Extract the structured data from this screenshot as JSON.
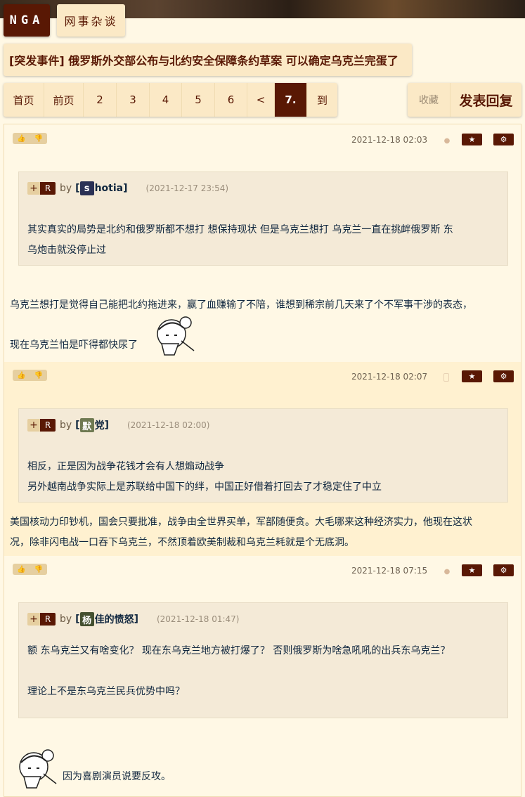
{
  "header": {
    "logo": "NGA",
    "section": "网事杂谈",
    "thread_title": "[突发事件] 俄罗斯外交部公布与北约安全保障条约草案 可以确定乌克兰完蛋了"
  },
  "pager": {
    "pages": [
      "首页",
      "前页",
      "2",
      "3",
      "4",
      "5",
      "6",
      "<",
      "7.",
      "到"
    ],
    "current": "7."
  },
  "actions": {
    "favorite": "收藏",
    "reply": "发表回复"
  },
  "colors": {
    "accent": "#591804",
    "quote_bg": "#f4ead7",
    "alt_row": "#fff1d0"
  },
  "posts": [
    {
      "date": "2021-12-18 02:03",
      "device_icon": "apple-icon",
      "quote": {
        "plus": "+",
        "r": "R",
        "by": "by",
        "user_open": "[",
        "user_initial": "s",
        "user_rest": "hotia",
        "user_close": "]",
        "time": "(2021-12-17 23:54)",
        "lines": [
          "其实真实的局势是北约和俄罗斯都不想打 想保持现状 但是乌克兰想打 乌克兰一直在挑衅俄罗斯 东",
          "乌炮击就没停止过"
        ]
      },
      "lines": [
        "乌克兰想打是觉得自己能把北约拖进来，赢了血赚输了不陪，谁想到稀宗前几天来了个不军事干涉的表态，",
        "现在乌克兰怕是吓得都快尿了"
      ]
    },
    {
      "date": "2021-12-18 02:07",
      "device_icon": "phone-icon",
      "quote": {
        "plus": "+",
        "r": "R",
        "by": "by",
        "user_open": "[",
        "user_initial": "默",
        "user_rest": "党",
        "user_close": "]",
        "time": "(2021-12-18 02:00)",
        "lines": [
          "相反，正是因为战争花钱才会有人想煽动战争",
          "另外越南战争实际上是苏联给中国下的绊，中国正好借着打回去了才稳定住了中立"
        ]
      },
      "lines": [
        "美国核动力印钞机，国会只要批准，战争由全世界买单，军部随便贪。大毛哪来这种经济实力，他现在这状",
        "况，除非闪电战一口吞下乌克兰，不然顶着欧美制裁和乌克兰耗就是个无底洞。"
      ]
    },
    {
      "date": "2021-12-18 07:15",
      "device_icon": "apple-icon",
      "quote": {
        "plus": "+",
        "r": "R",
        "by": "by",
        "user_open": "[",
        "user_initial": "杨",
        "user_rest": "佳的愤怒",
        "user_close": "]",
        "time": "(2021-12-18 01:47)",
        "lines": [
          "额 东乌克兰又有啥变化？ 现在东乌克兰地方被打爆了？ 否则俄罗斯为啥急吼吼的出兵东乌克兰？",
          "",
          "理论上不是东乌克兰民兵优势中吗？"
        ]
      },
      "lines": [
        "因为喜剧演员说要反攻。"
      ]
    }
  ]
}
